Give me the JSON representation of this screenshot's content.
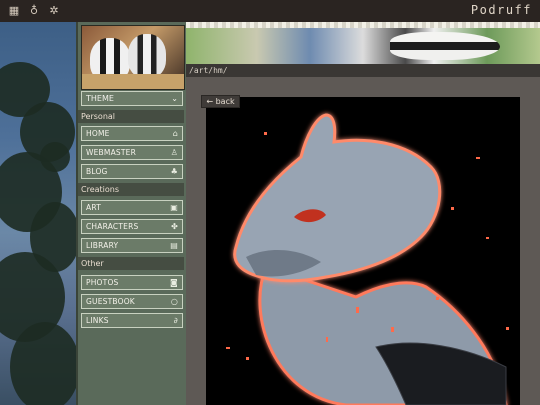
{
  "topbar": {
    "icons": [
      "grid-icon",
      "tooth-icon",
      "settings-icon"
    ],
    "site_title": "Podruff"
  },
  "sidebar": {
    "theme_label": "THEME",
    "sections": {
      "personal": "Personal",
      "creations": "Creations",
      "other": "Other"
    },
    "items": [
      {
        "label": "HOME",
        "icon": "home-icon"
      },
      {
        "label": "WEBMASTER",
        "icon": "user-icon"
      },
      {
        "label": "BLOG",
        "icon": "leaf-icon"
      },
      {
        "label": "ART",
        "icon": "image-icon"
      },
      {
        "label": "CHARACTERS",
        "icon": "paw-icon"
      },
      {
        "label": "LIBRARY",
        "icon": "book-icon"
      },
      {
        "label": "PHOTOS",
        "icon": "camera-icon"
      },
      {
        "label": "GUESTBOOK",
        "icon": "chat-icon"
      },
      {
        "label": "LINKS",
        "icon": "paperclip-icon"
      }
    ]
  },
  "path": "/art/hm/",
  "back_label": "← back",
  "colors": {
    "sidebar_bg": "#5a6a5a",
    "nav_item_bg": "#6b7b68",
    "section_bg": "#454d42",
    "content_bg": "#5e5955",
    "topbar_bg": "#2a2421",
    "glow": "#ff6a4a"
  }
}
